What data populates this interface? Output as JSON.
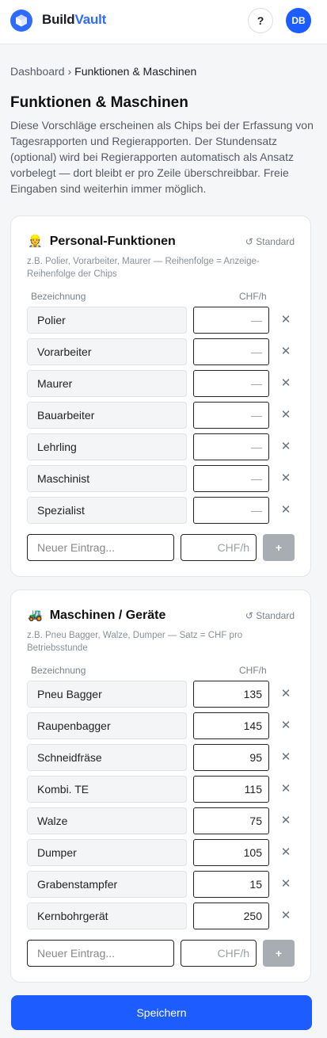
{
  "header": {
    "brand_primary": "Build",
    "brand_accent": "Vault",
    "help_label": "?",
    "avatar_initials": "DB"
  },
  "breadcrumb": {
    "root": "Dashboard",
    "separator": "›",
    "current": "Funktionen & Maschinen"
  },
  "page": {
    "title": "Funktionen & Maschinen",
    "description": "Diese Vorschläge erscheinen als Chips bei der Erfassung von Tagesrapporten und Regierapporten. Der Stundensatz (optional) wird bei Regierapporten automatisch als Ansatz vorbelegt — dort bleibt er pro Zeile überschreibbar. Freie Eingaben sind weiterhin immer möglich."
  },
  "personal": {
    "emoji": "👷",
    "title": "Personal-Funktionen",
    "standard_label": "↺ Standard",
    "hint": "z.B. Polier, Vorarbeiter, Maurer — Reihenfolge = Anzeige-Reihenfolge der Chips",
    "col_name": "Bezeichnung",
    "col_rate": "CHF/h",
    "rows": [
      {
        "name": "Polier",
        "rate": "—"
      },
      {
        "name": "Vorarbeiter",
        "rate": "—"
      },
      {
        "name": "Maurer",
        "rate": "—"
      },
      {
        "name": "Bauarbeiter",
        "rate": "—"
      },
      {
        "name": "Lehrling",
        "rate": "—"
      },
      {
        "name": "Maschinist",
        "rate": "—"
      },
      {
        "name": "Spezialist",
        "rate": "—"
      }
    ],
    "new_placeholder": "Neuer Eintrag...",
    "rate_placeholder": "CHF/h",
    "add_label": "+",
    "delete_label": "✕"
  },
  "machines": {
    "emoji": "🚜",
    "title": "Maschinen / Geräte",
    "standard_label": "↺ Standard",
    "hint": "z.B. Pneu Bagger, Walze, Dumper — Satz = CHF pro Betriebsstunde",
    "col_name": "Bezeichnung",
    "col_rate": "CHF/h",
    "rows": [
      {
        "name": "Pneu Bagger",
        "rate": "135"
      },
      {
        "name": "Raupenbagger",
        "rate": "145"
      },
      {
        "name": "Schneidfräse",
        "rate": "95"
      },
      {
        "name": "Kombi. TE",
        "rate": "115"
      },
      {
        "name": "Walze",
        "rate": "75"
      },
      {
        "name": "Dumper",
        "rate": "105"
      },
      {
        "name": "Grabenstampfer",
        "rate": "15"
      },
      {
        "name": "Kernbohrgerät",
        "rate": "250"
      }
    ],
    "new_placeholder": "Neuer Eintrag...",
    "rate_placeholder": "CHF/h",
    "add_label": "+",
    "delete_label": "✕"
  },
  "footer": {
    "save_label": "Speichern"
  },
  "colors": {
    "accent": "#1d5cff",
    "logo": "#2f6bff",
    "add_button_disabled": "#a8acb3"
  }
}
